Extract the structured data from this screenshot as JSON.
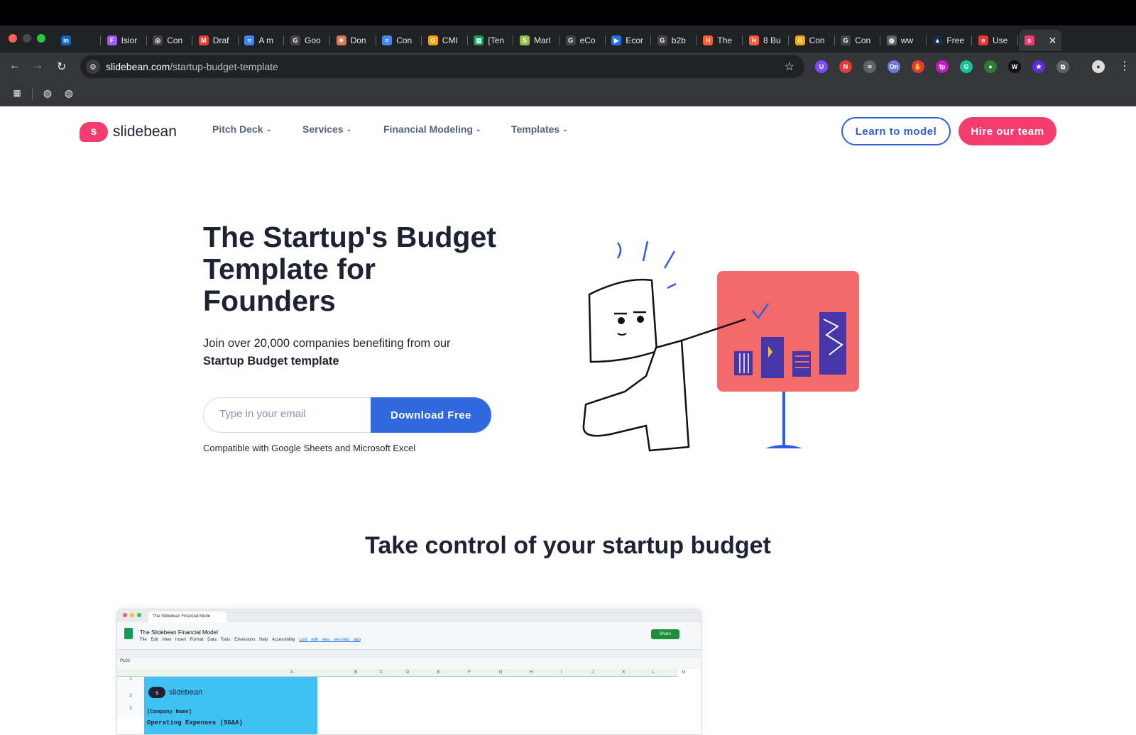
{
  "browser": {
    "tabs": [
      {
        "label": "",
        "icon": "linkedin-icon",
        "color": "#0a66c2",
        "glyph": "in"
      },
      {
        "label": "Isior",
        "icon": "figma-icon",
        "color": "#a259ff",
        "glyph": "F"
      },
      {
        "label": "Con",
        "icon": "chatgpt-icon",
        "color": "#444",
        "glyph": "◎"
      },
      {
        "label": "Draf",
        "icon": "gmail-icon",
        "color": "#ea4335",
        "glyph": "M"
      },
      {
        "label": "A m",
        "icon": "docs-icon",
        "color": "#4285f4",
        "glyph": "≡"
      },
      {
        "label": "Goo",
        "icon": "google-icon",
        "color": "#444",
        "glyph": "G"
      },
      {
        "label": "Don",
        "icon": "claude-icon",
        "color": "#d97757",
        "glyph": "✳"
      },
      {
        "label": "Con",
        "icon": "docs-icon",
        "color": "#4285f4",
        "glyph": "≡"
      },
      {
        "label": "CMI",
        "icon": "cmi-icon",
        "color": "#f7a600",
        "glyph": "G"
      },
      {
        "label": "[Ten",
        "icon": "sheets-icon",
        "color": "#0f9d58",
        "glyph": "▤"
      },
      {
        "label": "Marl",
        "icon": "shopify-icon",
        "color": "#95bf47",
        "glyph": "S"
      },
      {
        "label": "eCo",
        "icon": "google-icon",
        "color": "#444",
        "glyph": "G"
      },
      {
        "label": "Ecor",
        "icon": "play-icon",
        "color": "#1a73e8",
        "glyph": "▶"
      },
      {
        "label": "b2b",
        "icon": "google-icon",
        "color": "#444",
        "glyph": "G"
      },
      {
        "label": "The",
        "icon": "hubspot-icon",
        "color": "#ff5c35",
        "glyph": "H"
      },
      {
        "label": "8 Bu",
        "icon": "hubspot-icon",
        "color": "#ff5c35",
        "glyph": "H"
      },
      {
        "label": "Con",
        "icon": "cmi-icon",
        "color": "#f7a600",
        "glyph": "G"
      },
      {
        "label": "Con",
        "icon": "google-icon",
        "color": "#444",
        "glyph": "G"
      },
      {
        "label": "ww",
        "icon": "globe-icon",
        "color": "#5f6368",
        "glyph": "◍"
      },
      {
        "label": "Free",
        "icon": "dark-icon",
        "color": "#1c2a4a",
        "glyph": "▲"
      },
      {
        "label": "Use",
        "icon": "e-icon",
        "color": "#e53935",
        "glyph": "e"
      },
      {
        "label": "",
        "icon": "slidebean-icon",
        "color": "#f43c6f",
        "glyph": "s"
      }
    ],
    "new_tab": "+",
    "tab_menu": "⌄",
    "url_domain": "slidebean.com",
    "url_path": "/startup-budget-template",
    "extensions": [
      {
        "icon": "extension-purple-icon",
        "color": "#7b4dff",
        "glyph": "U"
      },
      {
        "icon": "extension-new-icon",
        "color": "#e53935",
        "glyph": "N"
      },
      {
        "icon": "crop-icon",
        "color": "#5f6368",
        "glyph": "⌗"
      },
      {
        "icon": "extension-on-icon",
        "color": "#6c7ae0",
        "glyph": "On"
      },
      {
        "icon": "extension-red-icon",
        "color": "#e53935",
        "glyph": "✋"
      },
      {
        "icon": "extension-fp-icon",
        "color": "#c21cc8",
        "glyph": "fp"
      },
      {
        "icon": "grammarly-icon",
        "color": "#15c39a",
        "glyph": "G"
      },
      {
        "icon": "extension-green-icon",
        "color": "#2e7d32",
        "glyph": "●"
      },
      {
        "icon": "extension-w-icon",
        "color": "#111",
        "glyph": "W"
      },
      {
        "icon": "extension-star-icon",
        "color": "#5b2dd9",
        "glyph": "★"
      },
      {
        "icon": "puzzle-icon",
        "color": "#5f6368",
        "glyph": "⧉"
      }
    ]
  },
  "site": {
    "logo_text": "slidebean",
    "logo_mark": "s",
    "nav": [
      "Pitch Deck",
      "Services",
      "Financial Modeling",
      "Templates"
    ],
    "learn_button": "Learn to model",
    "hire_button": "Hire our team"
  },
  "hero": {
    "title": "The Startup's Budget Template for Founders",
    "subtitle": "Join over 20,000 companies benefiting from our",
    "subtitle_bold": "Startup Budget template",
    "email_placeholder": "Type in your email",
    "download_button": "Download Free",
    "compat_note": "Compatible with Google Sheets and Microsoft Excel"
  },
  "section": {
    "title": "Take control of your startup budget"
  },
  "sheet_preview": {
    "tab_title": "The Slidebean Financial Mode",
    "doc_title": "The Slidebean Financial Model",
    "menu": "File Edit View Insert Format Data Tools Extensions Help Accessibility",
    "last_edit": "Last edit was seconds ago",
    "share": "Share",
    "cell_ref": "P102",
    "columns": [
      "A",
      "B",
      "C",
      "D",
      "E",
      "F",
      "G",
      "H",
      "I",
      "J",
      "K",
      "L",
      "M"
    ],
    "logo_text": "slidebean",
    "company_name": "[Company Name]",
    "next_row": "Operating Expenses (SG&A)"
  },
  "colors": {
    "brand_pink": "#f43c6f",
    "brand_blue": "#3068e0",
    "text_dark": "#1f2233"
  }
}
